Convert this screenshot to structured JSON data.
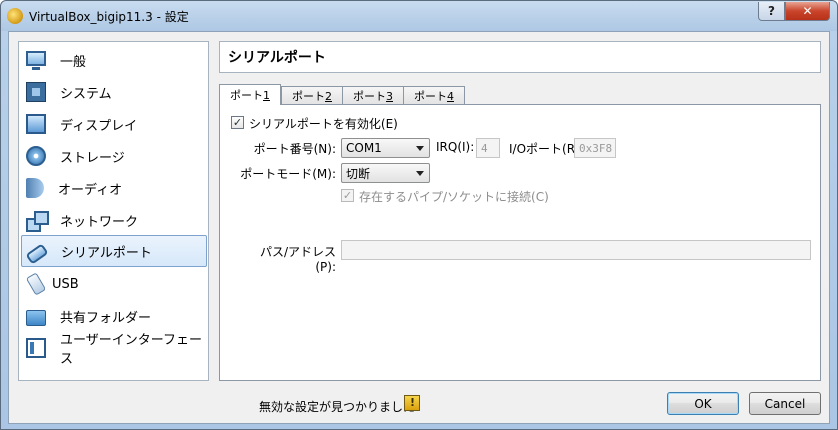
{
  "window": {
    "title": "VirtualBox_bigip11.3 - 設定",
    "help_glyph": "?",
    "close_glyph": "✕"
  },
  "sidebar": {
    "items": [
      {
        "label": "一般",
        "icon": "general-icon"
      },
      {
        "label": "システム",
        "icon": "system-icon"
      },
      {
        "label": "ディスプレイ",
        "icon": "display-icon"
      },
      {
        "label": "ストレージ",
        "icon": "storage-icon"
      },
      {
        "label": "オーディオ",
        "icon": "audio-icon"
      },
      {
        "label": "ネットワーク",
        "icon": "network-icon"
      },
      {
        "label": "シリアルポート",
        "icon": "serial-port-icon",
        "selected": true
      },
      {
        "label": "USB",
        "icon": "usb-icon"
      },
      {
        "label": "共有フォルダー",
        "icon": "shared-folder-icon"
      },
      {
        "label": "ユーザーインターフェース",
        "icon": "user-interface-icon"
      }
    ]
  },
  "panel": {
    "title": "シリアルポート",
    "tabs": [
      {
        "label": "ポート ",
        "num": "1",
        "active": true
      },
      {
        "label": "ポート ",
        "num": "2"
      },
      {
        "label": "ポート ",
        "num": "3"
      },
      {
        "label": "ポート ",
        "num": "4"
      }
    ],
    "enable_checkbox": {
      "label": "シリアルポートを有効化(E)",
      "checked": true,
      "check_glyph": "✓"
    },
    "port_number": {
      "label": "ポート番号(N):",
      "value": "COM1"
    },
    "irq": {
      "label": "IRQ(I):",
      "value": "4"
    },
    "io_port": {
      "label": "I/Oポート(R):",
      "value": "0x3F8"
    },
    "port_mode": {
      "label": "ポートモード(M):",
      "value": "切断"
    },
    "pipe_checkbox": {
      "label": "存在するパイプ/ソケットに接続(C)",
      "checked": true,
      "check_glyph": "✓"
    },
    "path": {
      "label": "パス/アドレス(P):",
      "value": ""
    }
  },
  "footer": {
    "status": "無効な設定が見つかりました",
    "warning_icon": "warning-icon",
    "ok_label": "OK",
    "cancel_label": "Cancel"
  }
}
